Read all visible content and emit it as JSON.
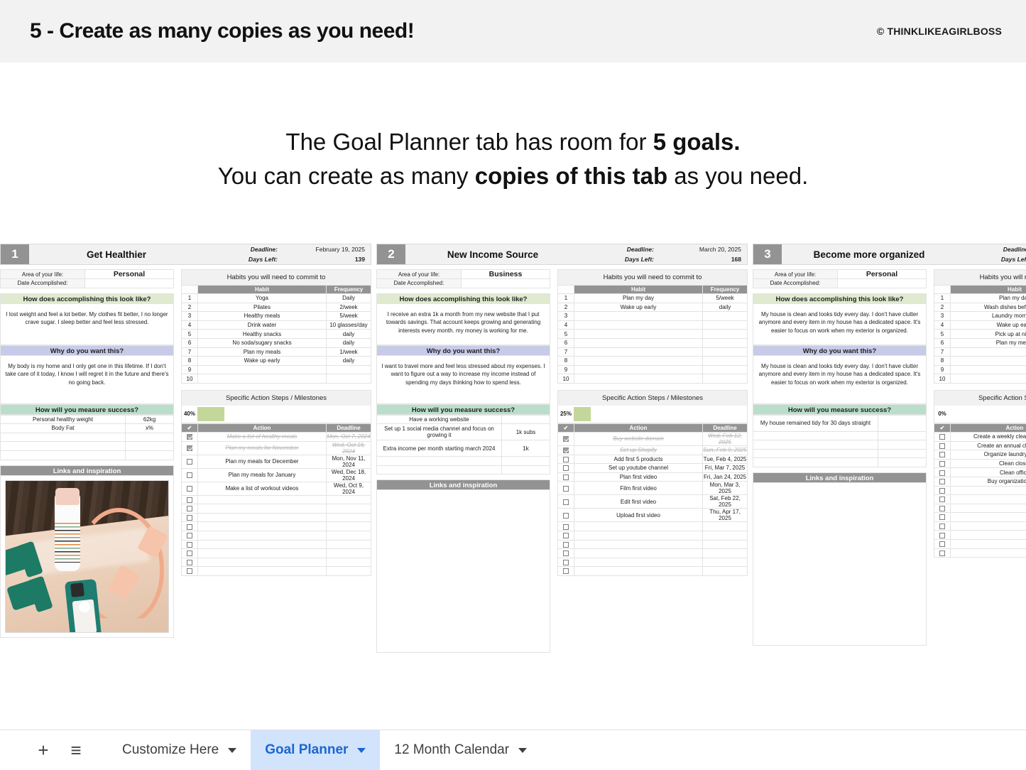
{
  "header": {
    "title": "5 - Create as many copies as you need!",
    "credit": "© THINKLIKEAGIRLBOSS"
  },
  "intro": {
    "line1_a": "The Goal Planner tab has room for ",
    "line1_b": "5 goals.",
    "line2_a": "You can create as many ",
    "line2_b": "copies of this tab",
    "line2_c": " as you need."
  },
  "labels": {
    "deadline": "Deadline:",
    "days_left": "Days Left:",
    "area_of_life": "Area of your life:",
    "date_accomplished": "Date Accomplished:",
    "look_like": "How does accomplishing this look like?",
    "why": "Why do you want this?",
    "measure": "How will you measure success?",
    "habits_title": "Habits you will need to commit to",
    "habits_num": "#",
    "habits_habit": "Habit",
    "habits_freq": "Frequency",
    "actions_title": "Specific Action Steps / Milestones",
    "actions_check": "✔",
    "actions_action": "Action",
    "actions_deadline": "Deadline",
    "links": "Links and inspiration"
  },
  "colors": {
    "banner_bg": "#f2f2f2",
    "grey_header": "#939393",
    "green_section": "#dfead0",
    "blue_section": "#c7cbe8",
    "mint_section": "#b9dfcb",
    "progress_fill": "#c3d79b",
    "tab_active_bg": "#d2e3fc",
    "tab_active_text": "#1967d2"
  },
  "goals": [
    {
      "number": "1",
      "title": "Get Healthier",
      "deadline": "February 19, 2025",
      "days_left": "139",
      "area": "Personal",
      "date_accomplished": "",
      "look_like": "I lost weight and feel a lot better. My clothes fit better, I no longer crave sugar. I sleep better and feel less stressed.",
      "why": "My body is my home and I only get one in this lifetime. If I don't take care of it today, I know I will regret it in the future and there's no going back.",
      "measures": [
        {
          "name": "Personal healthy weight",
          "value": "62kg"
        },
        {
          "name": "Body Fat",
          "value": "x%"
        },
        {
          "name": "",
          "value": ""
        },
        {
          "name": "",
          "value": ""
        },
        {
          "name": "",
          "value": ""
        }
      ],
      "habits": [
        {
          "n": "1",
          "habit": "Yoga",
          "freq": "Daily"
        },
        {
          "n": "2",
          "habit": "Pilates",
          "freq": "2/week"
        },
        {
          "n": "3",
          "habit": "Healthy meals",
          "freq": "5/week"
        },
        {
          "n": "4",
          "habit": "Drink water",
          "freq": "10 glasses/day"
        },
        {
          "n": "5",
          "habit": "Healthy snacks",
          "freq": "daily"
        },
        {
          "n": "6",
          "habit": "No soda/sugary snacks",
          "freq": "daily"
        },
        {
          "n": "7",
          "habit": "Plan my meals",
          "freq": "1/week"
        },
        {
          "n": "8",
          "habit": "Wake up early",
          "freq": "daily"
        },
        {
          "n": "9",
          "habit": "",
          "freq": ""
        },
        {
          "n": "10",
          "habit": "",
          "freq": ""
        }
      ],
      "progress_pct": "40%",
      "progress_value": 40,
      "actions": [
        {
          "done": true,
          "action": "Make a list of healthy meals",
          "deadline": "Mon, Oct 7, 2024"
        },
        {
          "done": true,
          "action": "Plan my meals for November",
          "deadline": "Wed, Oct 16, 2024"
        },
        {
          "done": false,
          "action": "Plan my meals for December",
          "deadline": "Mon, Nov 11, 2024"
        },
        {
          "done": false,
          "action": "Plan my meals for January",
          "deadline": "Wed, Dec 18, 2024"
        },
        {
          "done": false,
          "action": "Make a list of workout videos",
          "deadline": "Wed, Oct 9, 2024"
        }
      ],
      "action_blank_rows": 9,
      "has_photo": true
    },
    {
      "number": "2",
      "title": "New Income Source",
      "deadline": "March 20, 2025",
      "days_left": "168",
      "area": "Business",
      "date_accomplished": "",
      "look_like": "I receive an extra 1k a month from my new website that I put towards savings. That account keeps growing and generating interests every month. my money is working for me.",
      "why": "I want to travel more and feel less stressed about my expenses. I want to figure out a way to increase my income instead of spending my days thinking how to spend less.",
      "measures": [
        {
          "name": "Have a working website",
          "value": ""
        },
        {
          "name": "Set up 1 social media channel and focus on growing it",
          "value": "1k subs"
        },
        {
          "name": "Extra income per month starting march 2024",
          "value": "1k"
        },
        {
          "name": "",
          "value": ""
        },
        {
          "name": "",
          "value": ""
        }
      ],
      "habits": [
        {
          "n": "1",
          "habit": "Plan my day",
          "freq": "5/week"
        },
        {
          "n": "2",
          "habit": "Wake up early",
          "freq": "daily"
        },
        {
          "n": "3",
          "habit": "",
          "freq": ""
        },
        {
          "n": "4",
          "habit": "",
          "freq": ""
        },
        {
          "n": "5",
          "habit": "",
          "freq": ""
        },
        {
          "n": "6",
          "habit": "",
          "freq": ""
        },
        {
          "n": "7",
          "habit": "",
          "freq": ""
        },
        {
          "n": "8",
          "habit": "",
          "freq": ""
        },
        {
          "n": "9",
          "habit": "",
          "freq": ""
        },
        {
          "n": "10",
          "habit": "",
          "freq": ""
        }
      ],
      "progress_pct": "25%",
      "progress_value": 25,
      "actions": [
        {
          "done": true,
          "action": "Buy website domain",
          "deadline": "Wed, Feb 12, 2025"
        },
        {
          "done": true,
          "action": "Set up Shopify",
          "deadline": "Sun, Feb 9, 2025"
        },
        {
          "done": false,
          "action": "Add first 5 products",
          "deadline": "Tue, Feb 4, 2025"
        },
        {
          "done": false,
          "action": "Set up youtube channel",
          "deadline": "Fri, Mar 7, 2025"
        },
        {
          "done": false,
          "action": "Plan first video",
          "deadline": "Fri, Jan 24, 2025"
        },
        {
          "done": false,
          "action": "Film first video",
          "deadline": "Mon, Mar 3, 2025"
        },
        {
          "done": false,
          "action": "Edit first video",
          "deadline": "Sat, Feb 22, 2025"
        },
        {
          "done": false,
          "action": "Upload first video",
          "deadline": "Thu, Apr 17, 2025"
        }
      ],
      "action_blank_rows": 6,
      "has_photo": false
    },
    {
      "number": "3",
      "title": "Become more organized",
      "deadline": "",
      "days_left": "",
      "area": "Personal",
      "date_accomplished": "",
      "look_like": "My house is clean and looks tidy every day. I don't have clutter anymore and every item in my house has a dedicated space. It's easier to focus on work when my exterior is organized.",
      "why": "My house is clean and looks tidy every day. I don't have clutter anymore and every item in my house has a dedicated space. It's easier to focus on work when my exterior is organized.",
      "measures": [
        {
          "name": "My house remained tidy for 30 days straight",
          "value": ""
        },
        {
          "name": "",
          "value": ""
        },
        {
          "name": "",
          "value": ""
        },
        {
          "name": "",
          "value": ""
        },
        {
          "name": "",
          "value": ""
        }
      ],
      "habits": [
        {
          "n": "1",
          "habit": "Plan my day",
          "freq": ""
        },
        {
          "n": "2",
          "habit": "Wash dishes before bed",
          "freq": ""
        },
        {
          "n": "3",
          "habit": "Laundry mornings",
          "freq": ""
        },
        {
          "n": "4",
          "habit": "Wake up early",
          "freq": ""
        },
        {
          "n": "5",
          "habit": "Pick up at night",
          "freq": ""
        },
        {
          "n": "6",
          "habit": "Plan my meals",
          "freq": ""
        },
        {
          "n": "7",
          "habit": "",
          "freq": ""
        },
        {
          "n": "8",
          "habit": "",
          "freq": ""
        },
        {
          "n": "9",
          "habit": "",
          "freq": ""
        },
        {
          "n": "10",
          "habit": "",
          "freq": ""
        }
      ],
      "progress_pct": "0%",
      "progress_value": 0,
      "actions": [
        {
          "done": false,
          "action": "Create a weekly cleaning routine",
          "deadline": ""
        },
        {
          "done": false,
          "action": "Create an annual cleaning list",
          "deadline": ""
        },
        {
          "done": false,
          "action": "Organize laundry basket",
          "deadline": ""
        },
        {
          "done": false,
          "action": "Clean closet",
          "deadline": ""
        },
        {
          "done": false,
          "action": "Clean office",
          "deadline": ""
        },
        {
          "done": false,
          "action": "Buy organization bins",
          "deadline": ""
        }
      ],
      "action_blank_rows": 8,
      "has_photo": false
    }
  ],
  "tabbar": {
    "add_icon": "+",
    "menu_icon": "≡",
    "tabs": [
      {
        "label": "Customize Here",
        "active": false
      },
      {
        "label": "Goal Planner",
        "active": true
      },
      {
        "label": "12 Month Calendar",
        "active": false
      }
    ]
  }
}
